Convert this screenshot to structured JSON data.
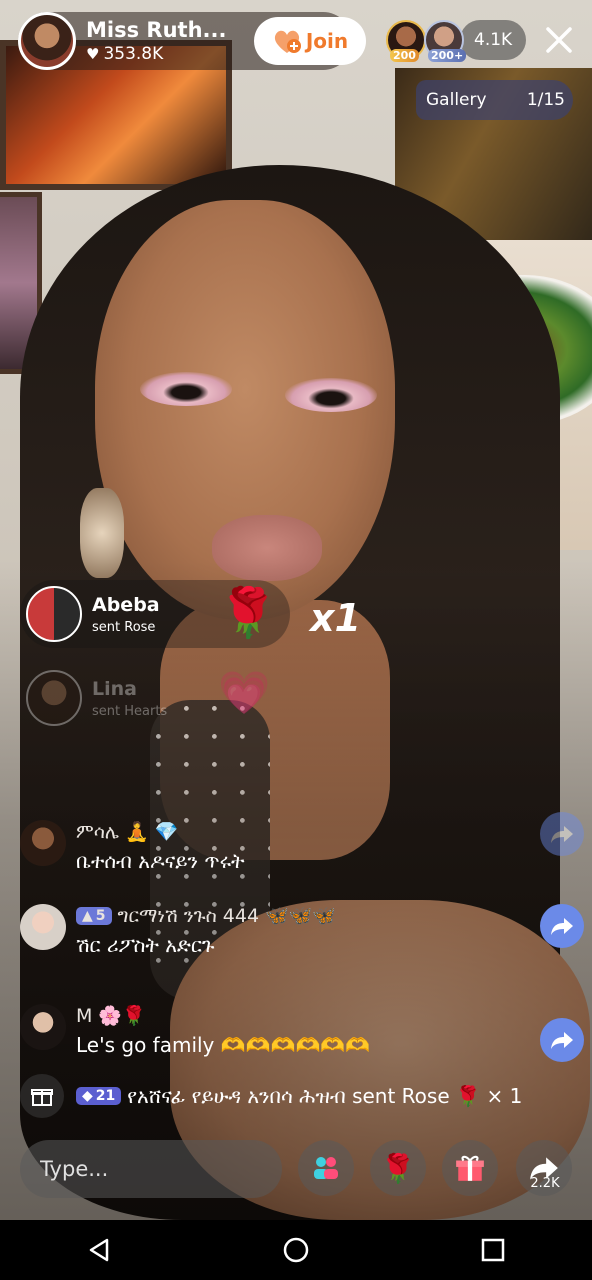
{
  "host": {
    "name": "Miss Ruth...",
    "likes": "353.8K",
    "join_label": "Join"
  },
  "viewers": {
    "badge1": "200",
    "badge2": "200+",
    "count": "4.1K"
  },
  "gallery": {
    "label": "Gallery",
    "count": "1/15"
  },
  "gift_announcements": [
    {
      "user": "Abeba",
      "action": "sent Rose",
      "multiplier": "x1"
    },
    {
      "user": "Lina",
      "action": "sent Hearts"
    }
  ],
  "chat": [
    {
      "name": "ምሳሌ",
      "message": "ቤተሰብ አዶናይን ጥሩት",
      "level": ""
    },
    {
      "name": "ግርማነሽ ንጉስ 444",
      "message": "ሽር ሪፖስት አድርጉ",
      "level": "5"
    },
    {
      "name": "M",
      "message": "Le's go family",
      "level": ""
    }
  ],
  "gift_ticker": {
    "level": "21",
    "text": "የአሸናፊ የይሁዳ አንበሳ ሕዝብ sent Rose",
    "multiplier": "× 1"
  },
  "input": {
    "placeholder": "Type..."
  },
  "share": {
    "count": "2.2K"
  },
  "colors": {
    "join_text": "#f07a2c",
    "level_badge": "#6b78d8",
    "share_fab": "#6b8ae8"
  },
  "icons": [
    "heart-icon",
    "join-icon",
    "close-icon",
    "share-icon",
    "gift-box-icon",
    "guest-icon",
    "rose-icon",
    "gift-icon",
    "back-icon",
    "home-icon",
    "recents-icon"
  ]
}
